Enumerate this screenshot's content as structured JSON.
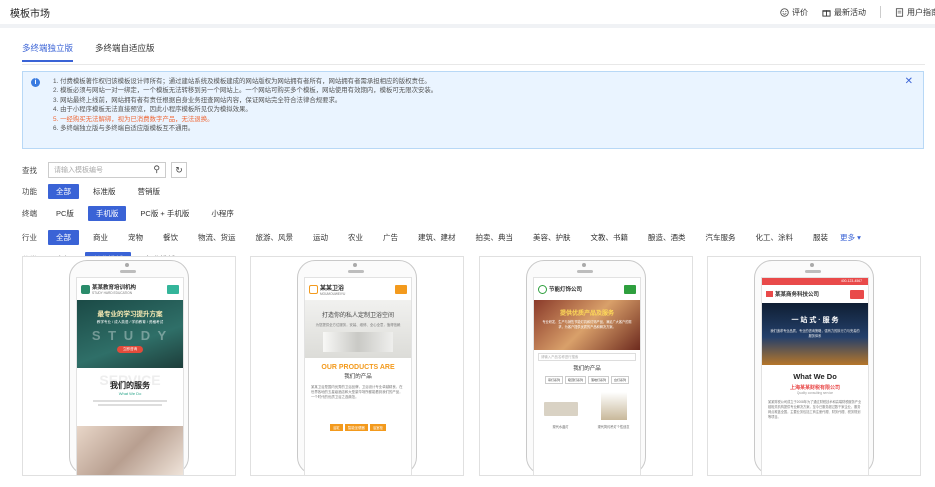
{
  "header": {
    "title": "模板市场",
    "rate": "评价",
    "news": "最新活动",
    "manual": "用户指南"
  },
  "tabs": [
    {
      "label": "多终端独立版",
      "active": true
    },
    {
      "label": "多终端自适应版",
      "active": false
    }
  ],
  "notice": {
    "lines": [
      "1. 付费模板著作权归该模板设计师所有；通过建站系统及模板建成的网站版权为网站拥有者所有，网站拥有者需承担相应的版权责任。",
      "2. 模板必须与网站一对一绑定，一个模板无法转移到另一个网站上。一个网站可购买多个模板，网站使用有效期内，模板可无限次安装。",
      "3. 网站最终上线前，网站拥有者有责任根据自身业务扭查网站内容，保证网站完全符合法律合规要求。",
      "4. 由于小程序模板无法直接预览，因此小程序模板所见仅为模拟效果。",
      "5. 一经购买无法解绑，视为已消费数字产品，无法退换。",
      "6. 多终端独立版与多终端自适应版模板互不通用。"
    ]
  },
  "filters": {
    "search": {
      "label": "查找",
      "placeholder": "请输入模板编号"
    },
    "function": {
      "label": "功能",
      "options": [
        "全部",
        "标准版",
        "营销版"
      ],
      "selected": 0
    },
    "terminal": {
      "label": "终端",
      "options": [
        "PC版",
        "手机版",
        "PC版 + 手机版",
        "小程序"
      ],
      "selected": 1
    },
    "industry": {
      "label": "行业",
      "options": [
        "全部",
        "商业",
        "宠物",
        "餐饮",
        "物流、货运",
        "旅游、风景",
        "运动",
        "农业",
        "广告",
        "建筑、建材",
        "拍卖、典当",
        "美容、护肤",
        "文教、书籍",
        "酿造、酒类",
        "汽车服务",
        "化工、涂料",
        "服装"
      ],
      "selected": 0,
      "more": "更多"
    },
    "category": {
      "label": "分类",
      "options": [
        "全部",
        "付费模板",
        "免费模板"
      ],
      "selected": 1
    }
  },
  "templates": [
    {
      "company": "某某教育培训机构",
      "sub": "STUDY HARD EDUCATION",
      "banner": "最专业的学习提升方案",
      "banner_sub": "教学专业 / 成人英语 / 学前教育 / 资格考试",
      "overlay": "S  T  U  D  Y",
      "btn": "立即咨询",
      "section_bg": "SERVICE",
      "section": "我们的服务",
      "section_en": "What We Do",
      "accent": "#2aa58a"
    },
    {
      "company": "某某卫浴",
      "sub": "MOUMOUWEIYU",
      "banner": "打造你的私人定制卫浴空间",
      "banner_sub": "为您提供全方位服务，安装、维修、全心全意，值得信赖",
      "section_en": "OUR PRODUCTS ARE",
      "section": "我们的产品",
      "body": "某某卫浴是国内优秀的卫浴品牌，卫浴设计专业卓越精良，在世界各地的五星级酒店和大型豪华场所都能看到我们的产品，一个时代的优质卫浴之选典范。",
      "btns": [
        "浴缸",
        "智能坐便器",
        "浴室柜"
      ],
      "accent": "#f39a1d"
    },
    {
      "company": "节能灯饰公司",
      "banner": "提供优质产品及服务",
      "banner_sub": "专业研发、生产与销售节能灯具和灯饰产品，满足广大客户的需求，为客户提供优质的产品和解决方案。",
      "search": "请输入产品名称进行搜索",
      "section": "我们的产品",
      "chips": [
        "吊灯系列",
        "吸顶灯系列",
        "落地灯系列",
        "台灯系列"
      ],
      "p1": "现代水晶灯",
      "p2": "现代简约吊灯个性创意",
      "accent": "#2e9f3e"
    },
    {
      "phone": "400-123-4567",
      "company": "某某商务科技公司",
      "banner": "一 站 式 · 服 务",
      "banner_sub": "我们追求专业品质，专业的咨询策略，强有力的执行力与完善的服务体系",
      "section_en": "What We Do",
      "section": "上海某某财税有限公司",
      "section_sub": "Quality consulting service",
      "body": "某某财税公司成立于2008年为了通过财税技术和高端财税服务产业链相关机构提供专业解决方案，至今已服务超过数千家企业，服务网点覆盖全国，主要业务包括工商注册代理、财务代理、税务规划等项目。",
      "accent": "#e94a4a"
    }
  ]
}
